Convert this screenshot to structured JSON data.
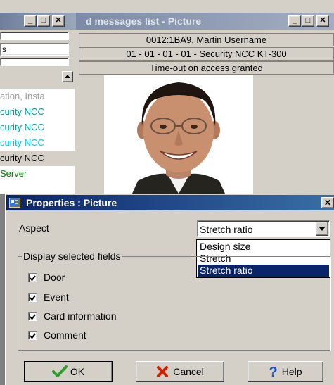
{
  "picture_window": {
    "title": "d messages list - Picture",
    "card_line": "0012:1BA9, Martin Username",
    "reader_line": "01 - 01 - 01 - 01 - Security NCC KT-300",
    "event_line": "Time-out on access granted"
  },
  "left_window": {
    "field_value": "s",
    "list_items": [
      {
        "label": "ation, Insta",
        "color": "#a0a0a0"
      },
      {
        "label": "curity NCC",
        "color": "#00a0a0"
      },
      {
        "label": "curity NCC",
        "color": "#00a0a0"
      },
      {
        "label": "curity NCC",
        "color": "#00c0ff"
      },
      {
        "label": "curity NCC",
        "color": "#000000"
      },
      {
        "label": "Server",
        "color": "#008000"
      }
    ]
  },
  "dialog": {
    "title": "Properties : Picture",
    "aspect_label": "Aspect",
    "aspect_value": "Stretch ratio",
    "aspect_options": [
      "Design size",
      "Stretch",
      "Stretch ratio"
    ],
    "group_label": "Display selected fields",
    "fields": [
      {
        "label": "Door",
        "checked": true
      },
      {
        "label": "Event",
        "checked": true
      },
      {
        "label": "Card information",
        "checked": true
      },
      {
        "label": "Comment",
        "checked": true
      }
    ],
    "ok_label": "OK",
    "cancel_label": "Cancel",
    "help_label": "Help"
  },
  "colors": {
    "dialog_title_bar": "#0a246a",
    "selection": "#0a246a",
    "ok_icon": "#2e9d2e",
    "cancel_icon": "#d02000",
    "help_icon": "#1a4fd8"
  }
}
